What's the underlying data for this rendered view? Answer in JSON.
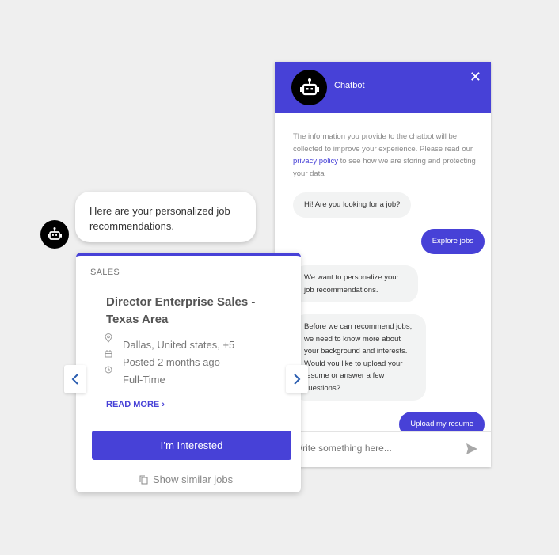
{
  "colors": {
    "accent": "#4741d7",
    "background": "#efefef",
    "bubble": "#f2f3f3"
  },
  "chat": {
    "title": "Chatbot",
    "close_icon": "close-icon",
    "disclaimer_before": "The information you provide to the chatbot will be collected to improve your experience. Please read our",
    "privacy_link": "privacy policy",
    "disclaimer_after": " to see how we are storing and protecting your data",
    "messages": [
      {
        "from": "bot",
        "text": "Hi! Are you looking for a job?"
      },
      {
        "from": "user",
        "text": "Explore jobs"
      },
      {
        "from": "bot",
        "text": "We want to personalize your job recommendations."
      },
      {
        "from": "bot",
        "text": "Before we can recommend jobs, we need to know more about your background and interests. Would you like to upload your resume or answer a few questions?"
      },
      {
        "from": "user",
        "text": "Upload my resume"
      }
    ],
    "input_placeholder": "Write something here..."
  },
  "bot_message": "Here are your personalized job recommendations.",
  "job_card": {
    "category": "SALES",
    "title": "Director Enterprise Sales - Texas Area",
    "location": "Dallas, United states, +5",
    "posted": "Posted 2 months ago",
    "type": "Full-Time",
    "read_more": "READ MORE",
    "interested_label": "I’m Interested",
    "similar_label": "Show similar jobs"
  }
}
